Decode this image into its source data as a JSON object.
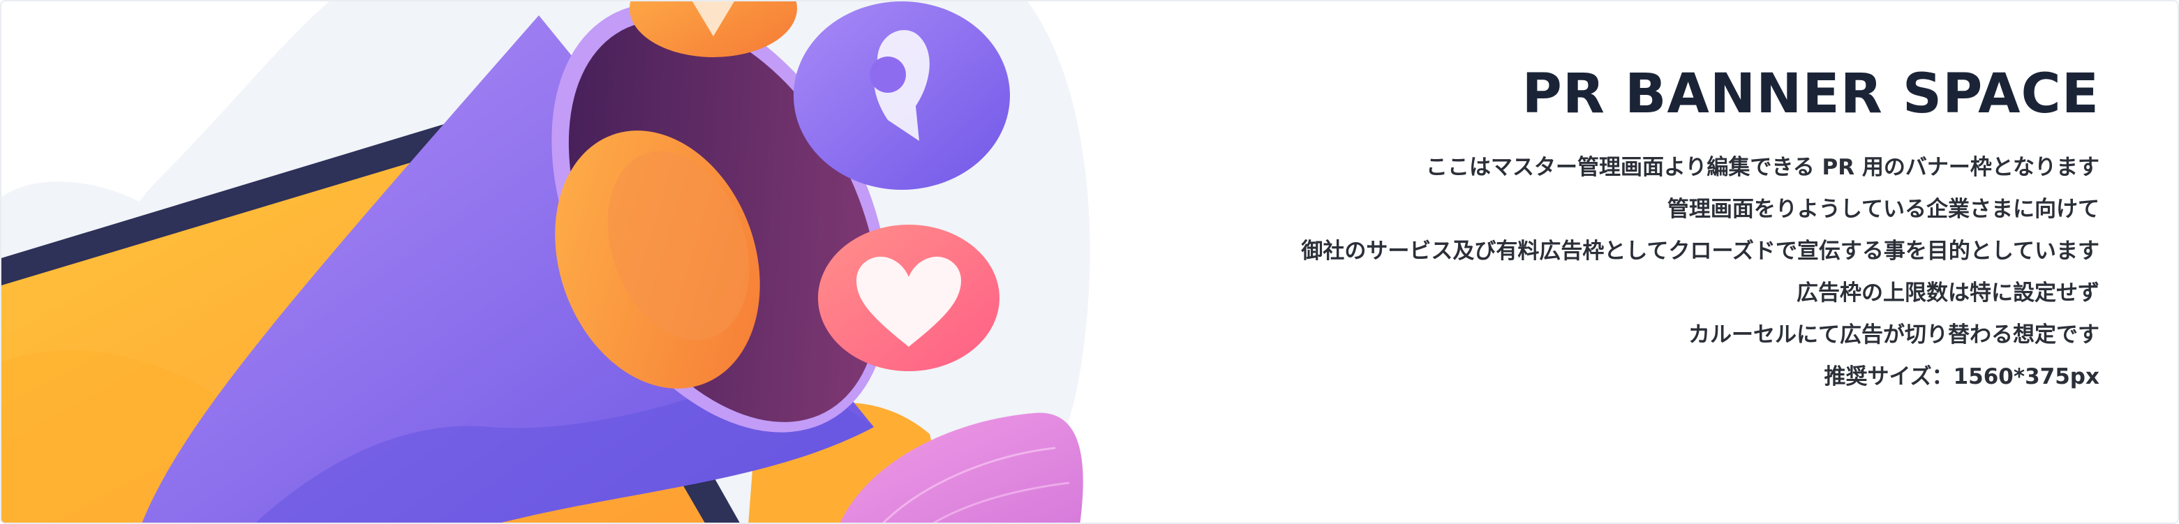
{
  "banner": {
    "title": "PR BANNER SPACE",
    "lines": [
      "ここはマスター管理画面より編集できる PR 用のバナー枠となります",
      "管理画面をりようしている企業さまに向けて",
      "御社のサービス及び有料広告枠としてクローズドで宣伝する事を目的としています",
      "広告枠の上限数は特に設定せず",
      "カルーセルにて広告が切り替わる想定です",
      "推奨サイズ：1560*375px"
    ],
    "illustration": {
      "icons": [
        "megaphone-icon",
        "monitor-icon",
        "location-pin-icon",
        "heart-icon",
        "leaf-icon"
      ],
      "colors": {
        "background_blob": "#f1f4f8",
        "monitor_frame": "#2e3158",
        "monitor_screen": "#ffb83b",
        "megaphone_body": "#8a68ec",
        "megaphone_inner": "#5a2a6a",
        "megaphone_ring": "#ff9a3c",
        "pin_bubble": "#8e6cf0",
        "heart_bubble": "#ff6d82",
        "leaf": "#e58ee0"
      }
    }
  }
}
